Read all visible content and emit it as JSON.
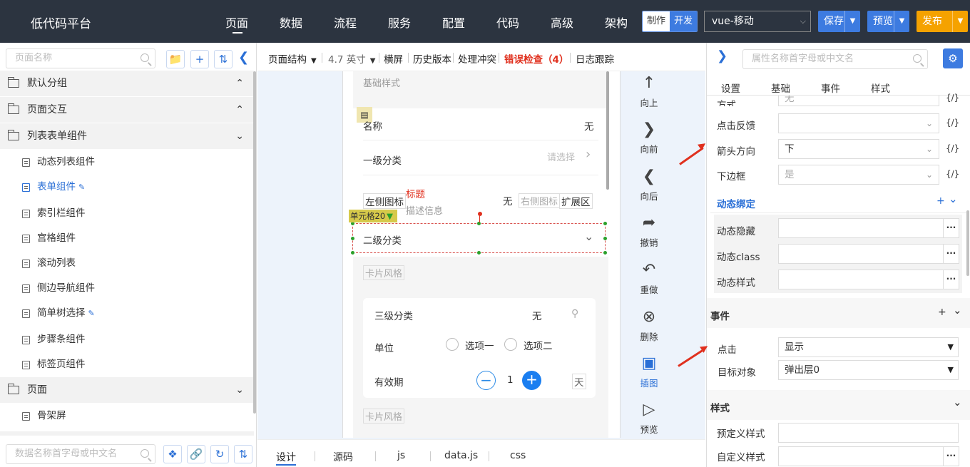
{
  "topbar": {
    "logo": "低代码平台",
    "nav": [
      "页面",
      "数据",
      "流程",
      "服务",
      "配置",
      "代码",
      "高级",
      "架构"
    ],
    "mode_make": "制作",
    "mode_dev": "开发",
    "platform_select": "vue-移动",
    "save": "保存",
    "preview": "预览",
    "publish": "发布"
  },
  "left": {
    "search_placeholder": "页面名称",
    "groups": [
      {
        "label": "默认分组",
        "expanded": true
      },
      {
        "label": "页面交互",
        "expanded": true
      },
      {
        "label": "列表表单组件",
        "expanded": false
      }
    ],
    "items": [
      "动态列表组件",
      "表单组件",
      "索引栏组件",
      "宫格组件",
      "滚动列表",
      "侧边导航组件",
      "简单树选择",
      "步骤条组件",
      "标签页组件"
    ],
    "group_page": "页面",
    "item_skeleton": "骨架屏",
    "bottom_search_placeholder": "数据名称首字母或中文名"
  },
  "toolbar": {
    "page_structure": "页面结构",
    "screen_size": "4.7 英寸",
    "landscape": "横屏",
    "history": "历史版本",
    "conflict": "处理冲突",
    "error_check": "错误检查（4）",
    "log": "日志跟踪"
  },
  "phone": {
    "section_basic": "基础样式",
    "name_label": "名称",
    "name_value": "无",
    "level1_label": "一级分类",
    "level1_placeholder": "请选择",
    "left_icon_label": "左侧图标",
    "title_red": "标题",
    "desc": "描述信息",
    "left_icon_value": "无",
    "right_icon": "右侧图标",
    "extend_area": "扩展区",
    "cell_tag": "单元格20",
    "level2_label": "二级分类",
    "section_card1": "卡片风格",
    "level3_label": "三级分类",
    "level3_value": "无",
    "unit_label": "单位",
    "option1": "选项一",
    "option2": "选项二",
    "validity_label": "有效期",
    "stepper_value": "1",
    "day_unit": "天",
    "section_card2": "卡片风格"
  },
  "canvas_tools": [
    "向上",
    "向前",
    "向后",
    "撤销",
    "重做",
    "删除",
    "插图",
    "预览"
  ],
  "bottom_tabs": [
    "设计",
    "源码",
    "js",
    "data.js",
    "css"
  ],
  "right": {
    "search_placeholder": "属性名称首字母或中文名",
    "tabs": [
      "设置",
      "基础",
      "事件",
      "样式"
    ],
    "method_label": "方式",
    "method_value": "无",
    "click_feedback_label": "点击反馈",
    "click_feedback_value": "",
    "arrow_direction_label": "箭头方向",
    "arrow_direction_value": "下",
    "bottom_border_label": "下边框",
    "bottom_border_value": "是",
    "fx": "{/}",
    "dynamic_binding": "动态绑定",
    "dynamic_hide": "动态隐藏",
    "dynamic_class": "动态class",
    "dynamic_style": "动态样式",
    "events_section": "事件",
    "click_label": "点击",
    "click_value": "显示",
    "target_label": "目标对象",
    "target_value": "弹出层0",
    "style_section": "样式",
    "preset_style": "预定义样式",
    "custom_style": "自定义样式"
  },
  "colors": {
    "topbar_bg": "#2c3440",
    "accent_blue": "#2a6fd6",
    "publish_orange": "#f5a200",
    "error_red": "#e0301e"
  }
}
